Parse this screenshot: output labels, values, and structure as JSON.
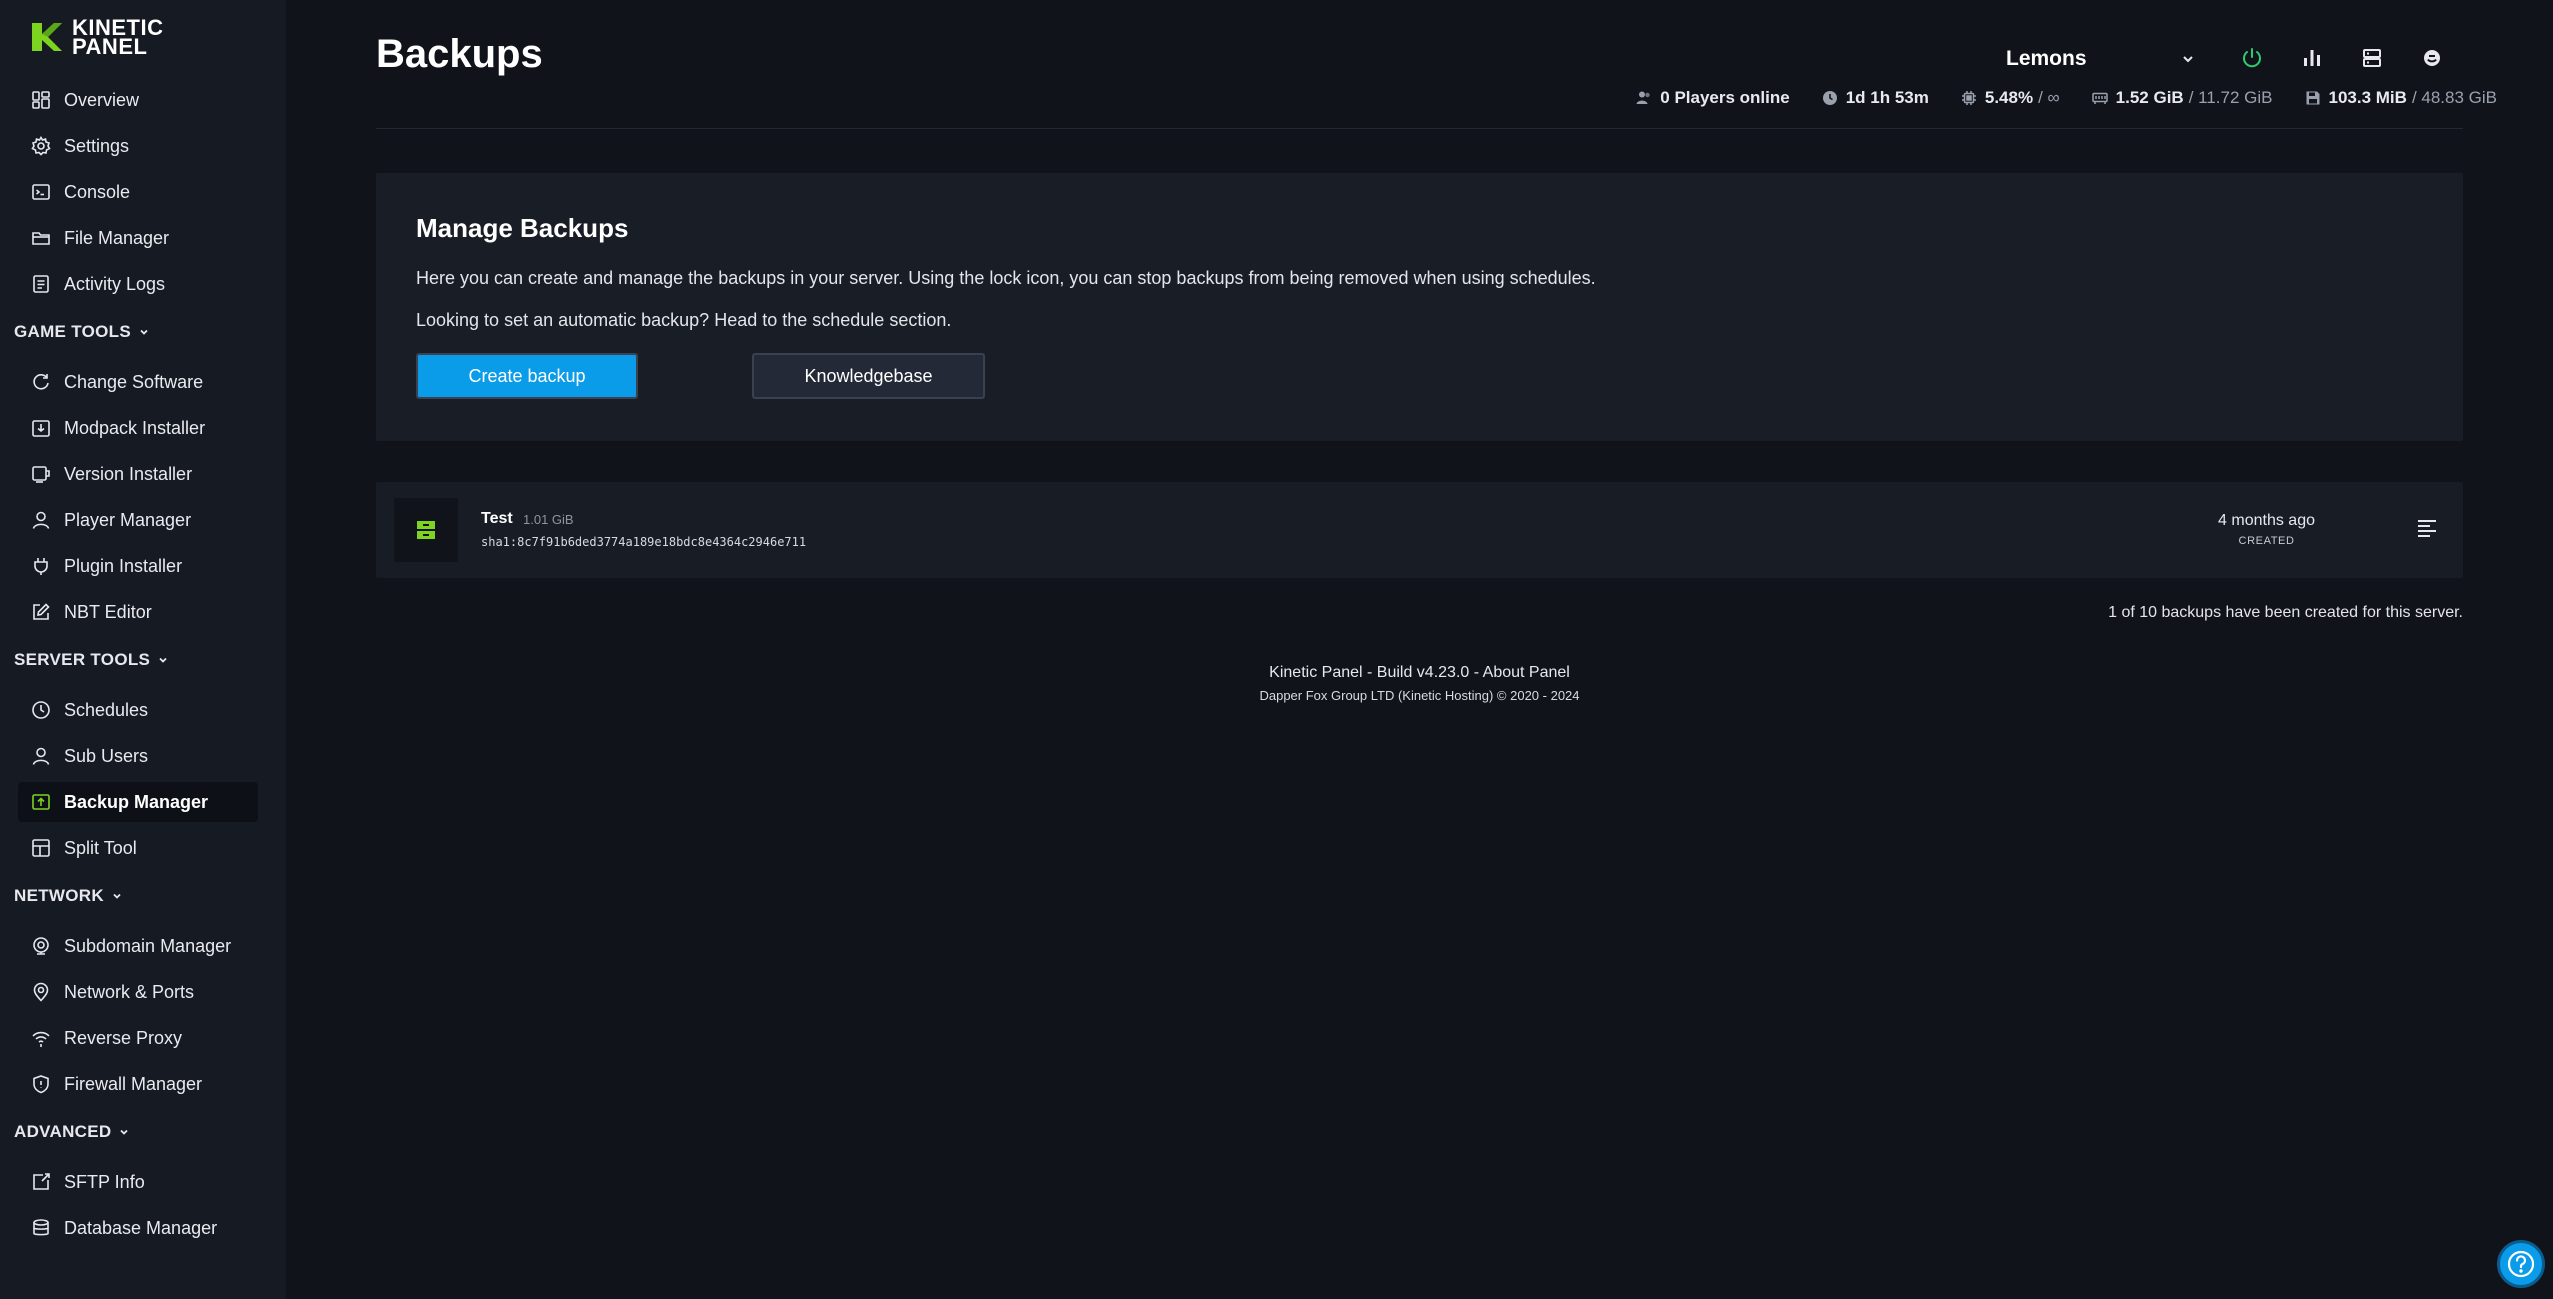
{
  "brand": {
    "line1": "KINETIC",
    "line2": "PANEL",
    "accent": "#7ed321",
    "primary": "#0a9be9"
  },
  "sidebar": {
    "top_items": [
      {
        "label": "Overview",
        "icon": "grid-icon"
      },
      {
        "label": "Settings",
        "icon": "gear-icon"
      },
      {
        "label": "Console",
        "icon": "terminal-icon"
      },
      {
        "label": "File Manager",
        "icon": "folder-icon"
      },
      {
        "label": "Activity Logs",
        "icon": "list-icon"
      }
    ],
    "game_tools": {
      "title": "GAME TOOLS",
      "items": [
        {
          "label": "Change Software",
          "icon": "refresh-icon"
        },
        {
          "label": "Modpack Installer",
          "icon": "download-box-icon"
        },
        {
          "label": "Version Installer",
          "icon": "cube-icon"
        },
        {
          "label": "Player Manager",
          "icon": "user-icon"
        },
        {
          "label": "Plugin Installer",
          "icon": "plug-icon"
        },
        {
          "label": "NBT Editor",
          "icon": "edit-icon"
        }
      ]
    },
    "server_tools": {
      "title": "SERVER TOOLS",
      "items": [
        {
          "label": "Schedules",
          "icon": "clock-icon"
        },
        {
          "label": "Sub Users",
          "icon": "user-icon"
        },
        {
          "label": "Backup Manager",
          "icon": "backup-icon",
          "active": true
        },
        {
          "label": "Split Tool",
          "icon": "split-icon"
        }
      ]
    },
    "network": {
      "title": "NETWORK",
      "items": [
        {
          "label": "Subdomain Manager",
          "icon": "globe-icon"
        },
        {
          "label": "Network & Ports",
          "icon": "pin-icon"
        },
        {
          "label": "Reverse Proxy",
          "icon": "wifi-icon"
        },
        {
          "label": "Firewall Manager",
          "icon": "shield-icon"
        }
      ]
    },
    "advanced": {
      "title": "ADVANCED",
      "items": [
        {
          "label": "SFTP Info",
          "icon": "sftp-icon"
        },
        {
          "label": "Database Manager",
          "icon": "database-icon"
        }
      ]
    }
  },
  "header": {
    "title": "Backups",
    "server_name": "Lemons",
    "stats": {
      "players": "0 Players online",
      "uptime": "1d 1h 53m",
      "cpu": "5.48%",
      "cpu_limit": "/ ∞",
      "memory": "1.52 GiB",
      "memory_limit": "/ 11.72 GiB",
      "disk": "103.3 MiB",
      "disk_limit": "/ 48.83 GiB"
    }
  },
  "manage": {
    "title": "Manage Backups",
    "description": "Here you can create and manage the backups in your server. Using the lock icon, you can stop backups from being removed when using schedules.",
    "hint": "Looking to set an automatic backup? Head to the schedule section.",
    "create_label": "Create backup",
    "kb_label": "Knowledgebase"
  },
  "backup": {
    "name": "Test",
    "size": "1.01 GiB",
    "hash": "sha1:8c7f91b6ded3774a189e18bdc8e4364c2946e711",
    "when": "4 months ago",
    "when_label": "CREATED"
  },
  "count_text": "1 of 10 backups have been created for this server.",
  "footer": {
    "product": "Kinetic Panel",
    "sep1": " - ",
    "build": "Build v4.23.0",
    "sep2": " - ",
    "about": "About Panel",
    "copyright": "Dapper Fox Group LTD (Kinetic Hosting) © 2020 - 2024"
  }
}
